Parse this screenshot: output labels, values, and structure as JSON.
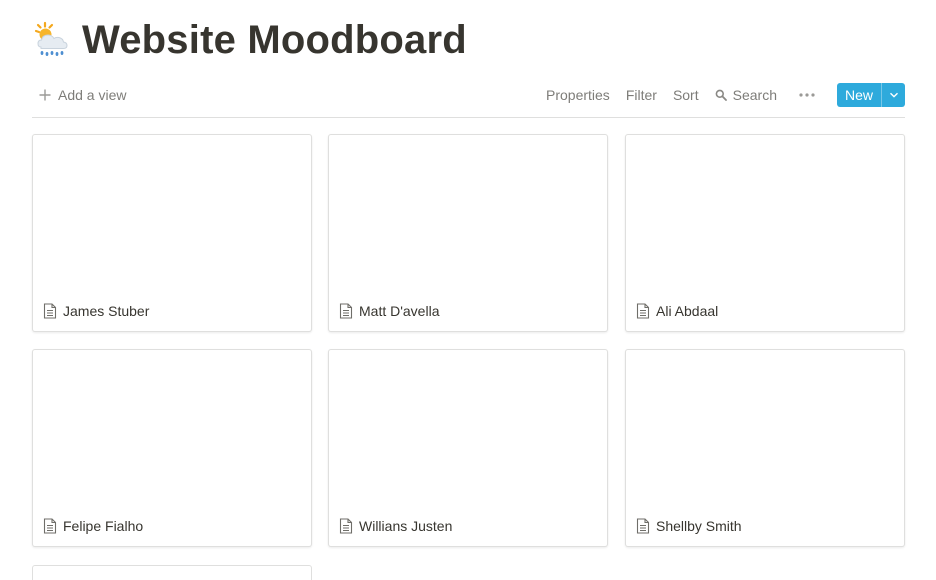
{
  "page": {
    "title": "Website Moodboard",
    "icon": "sun-behind-rain-cloud-icon"
  },
  "toolbar": {
    "add_view_label": "Add a view",
    "properties_label": "Properties",
    "filter_label": "Filter",
    "sort_label": "Sort",
    "search_label": "Search",
    "new_label": "New"
  },
  "colors": {
    "accent": "#2eaadc",
    "text": "#37352f"
  },
  "gallery": {
    "cards": [
      {
        "title": "James Stuber",
        "icon": "page-icon"
      },
      {
        "title": "Matt D'avella",
        "icon": "page-icon"
      },
      {
        "title": "Ali Abdaal",
        "icon": "page-icon"
      },
      {
        "title": "Felipe Fialho",
        "icon": "page-icon"
      },
      {
        "title": "Willians Justen",
        "icon": "page-icon"
      },
      {
        "title": "Shellby Smith",
        "icon": "page-icon"
      }
    ]
  }
}
